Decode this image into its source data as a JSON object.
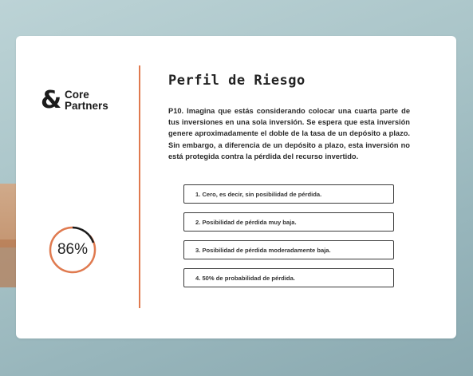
{
  "brand": {
    "symbol": "&",
    "line1": "Core",
    "line2": "Partners"
  },
  "progress": {
    "percent": 86,
    "label": "86%",
    "color": "#e07a4f"
  },
  "section": {
    "title": "Perfil de Riesgo"
  },
  "question": {
    "text": "P10. Imagina que estás considerando colocar una cuarta parte de tus inversiones en una sola inversión. Se espera que esta inversión genere aproximadamente el doble de la tasa de un depósito a plazo. Sin embargo, a diferencia de un depósito a plazo, esta inversión no está protegida contra la pérdida del recurso invertido."
  },
  "options": [
    {
      "label": "1. Cero, es decir, sin posibilidad de pérdida."
    },
    {
      "label": "2. Posibilidad de pérdida muy baja."
    },
    {
      "label": "3. Posibilidad de pérdida moderadamente baja."
    },
    {
      "label": "4. 50% de probabilidad de pérdida."
    }
  ]
}
